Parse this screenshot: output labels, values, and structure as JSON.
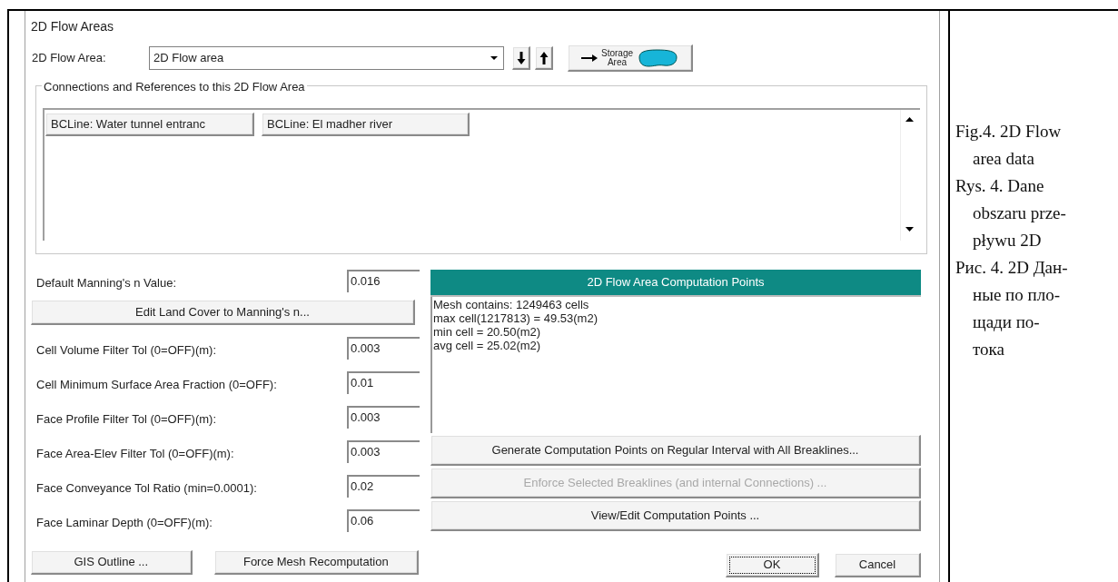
{
  "dialog": {
    "title": "2D Flow Areas",
    "flow_area": {
      "label": "2D Flow Area:",
      "value": "2D Flow area"
    },
    "storage_button": {
      "lines": [
        "Storage",
        "Area"
      ]
    },
    "connections": {
      "title": "Connections and References to this 2D Flow Area",
      "items": [
        "BCLine: Water tunnel entranc",
        "BCLine: El madher river"
      ]
    },
    "manning": {
      "label": "Default Manning's n Value:",
      "value": "0.016"
    },
    "land_cover_button": "Edit Land Cover to Manning's n...",
    "params": [
      {
        "label": "Cell Volume Filter Tol (0=OFF)(m):",
        "value": "0.003"
      },
      {
        "label": "Cell Minimum Surface Area Fraction (0=OFF):",
        "value": "0.01"
      },
      {
        "label": "Face Profile Filter Tol (0=OFF)(m):",
        "value": "0.003"
      },
      {
        "label": "Face Area-Elev Filter Tol (0=OFF)(m):",
        "value": "0.003"
      },
      {
        "label": "Face Conveyance Tol Ratio (min=0.0001):",
        "value": "0.02"
      },
      {
        "label": "Face Laminar Depth (0=OFF)(m):",
        "value": "0.06"
      }
    ],
    "computation": {
      "title": "2D Flow Area Computation Points",
      "lines": [
        "Mesh contains: 1249463 cells",
        "max cell(1217813) = 49.53(m2)",
        "min cell = 20.50(m2)",
        "avg cell = 25.02(m2)"
      ]
    },
    "actions": [
      {
        "label": "Generate Computation Points on Regular Interval with All Breaklines...",
        "disabled": false
      },
      {
        "label": "Enforce Selected Breaklines (and internal Connections) ...",
        "disabled": true
      },
      {
        "label": "View/Edit Computation Points ...",
        "disabled": false
      }
    ],
    "footer_left": [
      {
        "label": "GIS Outline ...",
        "focused": false
      },
      {
        "label": "Force Mesh Recomputation",
        "focused": false
      }
    ],
    "footer_right": [
      {
        "label": "OK",
        "focused": true
      },
      {
        "label": "Cancel",
        "focused": false
      }
    ]
  },
  "captions": [
    {
      "lines": [
        "Fig.4. 2D Flow",
        "area data"
      ]
    },
    {
      "lines": [
        "Rys. 4. Dane",
        "obszaru prze-",
        "pływu 2D"
      ]
    },
    {
      "lines": [
        "Рис. 4. 2D Дан-",
        "ные по пло-",
        "щади по-",
        "тока"
      ]
    }
  ]
}
